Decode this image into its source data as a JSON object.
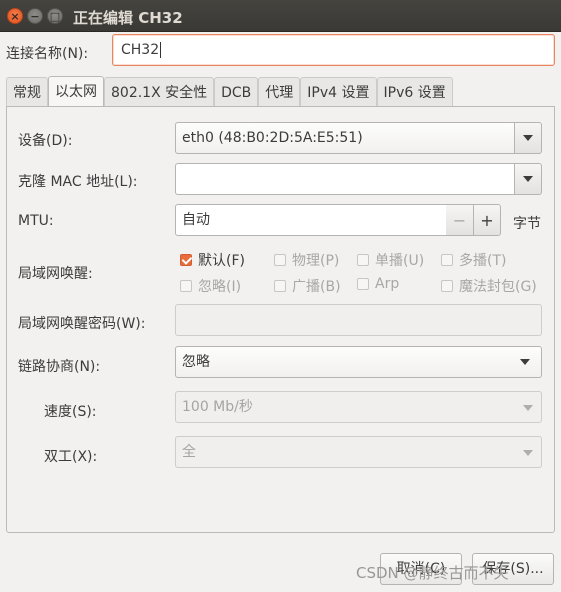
{
  "window": {
    "title": "正在编辑 CH32",
    "close_glyph": "×",
    "min_glyph": "−",
    "max_glyph": "□"
  },
  "connection": {
    "label": "连接名称(N):",
    "value": "CH32"
  },
  "tabs": [
    {
      "label": "常规",
      "active": false
    },
    {
      "label": "以太网",
      "active": true
    },
    {
      "label": "802.1X 安全性",
      "active": false
    },
    {
      "label": "DCB",
      "active": false
    },
    {
      "label": "代理",
      "active": false
    },
    {
      "label": "IPv4 设置",
      "active": false
    },
    {
      "label": "IPv6 设置",
      "active": false
    }
  ],
  "ethernet": {
    "device": {
      "label": "设备(D):",
      "value": "eth0 (48:B0:2D:5A:E5:51)"
    },
    "cloned_mac": {
      "label": "克隆 MAC 地址(L):",
      "value": ""
    },
    "mtu": {
      "label": "MTU:",
      "value": "自动",
      "minus": "−",
      "plus": "+",
      "unit": "字节"
    },
    "wol": {
      "label": "局域网唤醒:",
      "options": [
        {
          "label": "默认(F)",
          "checked": true,
          "enabled": true
        },
        {
          "label": "物理(P)",
          "checked": false,
          "enabled": false
        },
        {
          "label": "单播(U)",
          "checked": false,
          "enabled": false
        },
        {
          "label": "多播(T)",
          "checked": false,
          "enabled": false
        },
        {
          "label": "忽略(I)",
          "checked": false,
          "enabled": false
        },
        {
          "label": "广播(B)",
          "checked": false,
          "enabled": false
        },
        {
          "label": "Arp",
          "checked": false,
          "enabled": false
        },
        {
          "label": "魔法封包(G)",
          "checked": false,
          "enabled": false
        }
      ]
    },
    "wol_password": {
      "label": "局域网唤醒密码(W):",
      "value": ""
    },
    "link_negotiation": {
      "label": "链路协商(N):",
      "value": "忽略"
    },
    "speed": {
      "label": "速度(S):",
      "value": "100 Mb/秒"
    },
    "duplex": {
      "label": "双工(X):",
      "value": "全"
    }
  },
  "buttons": {
    "cancel": "取消(C)",
    "save": "保存(S)..."
  },
  "watermark": "CSDN @静终古而不失",
  "colors": {
    "accent": "#e86d3d",
    "titlebar": "#3c3b37",
    "background": "#f2f1f0"
  }
}
